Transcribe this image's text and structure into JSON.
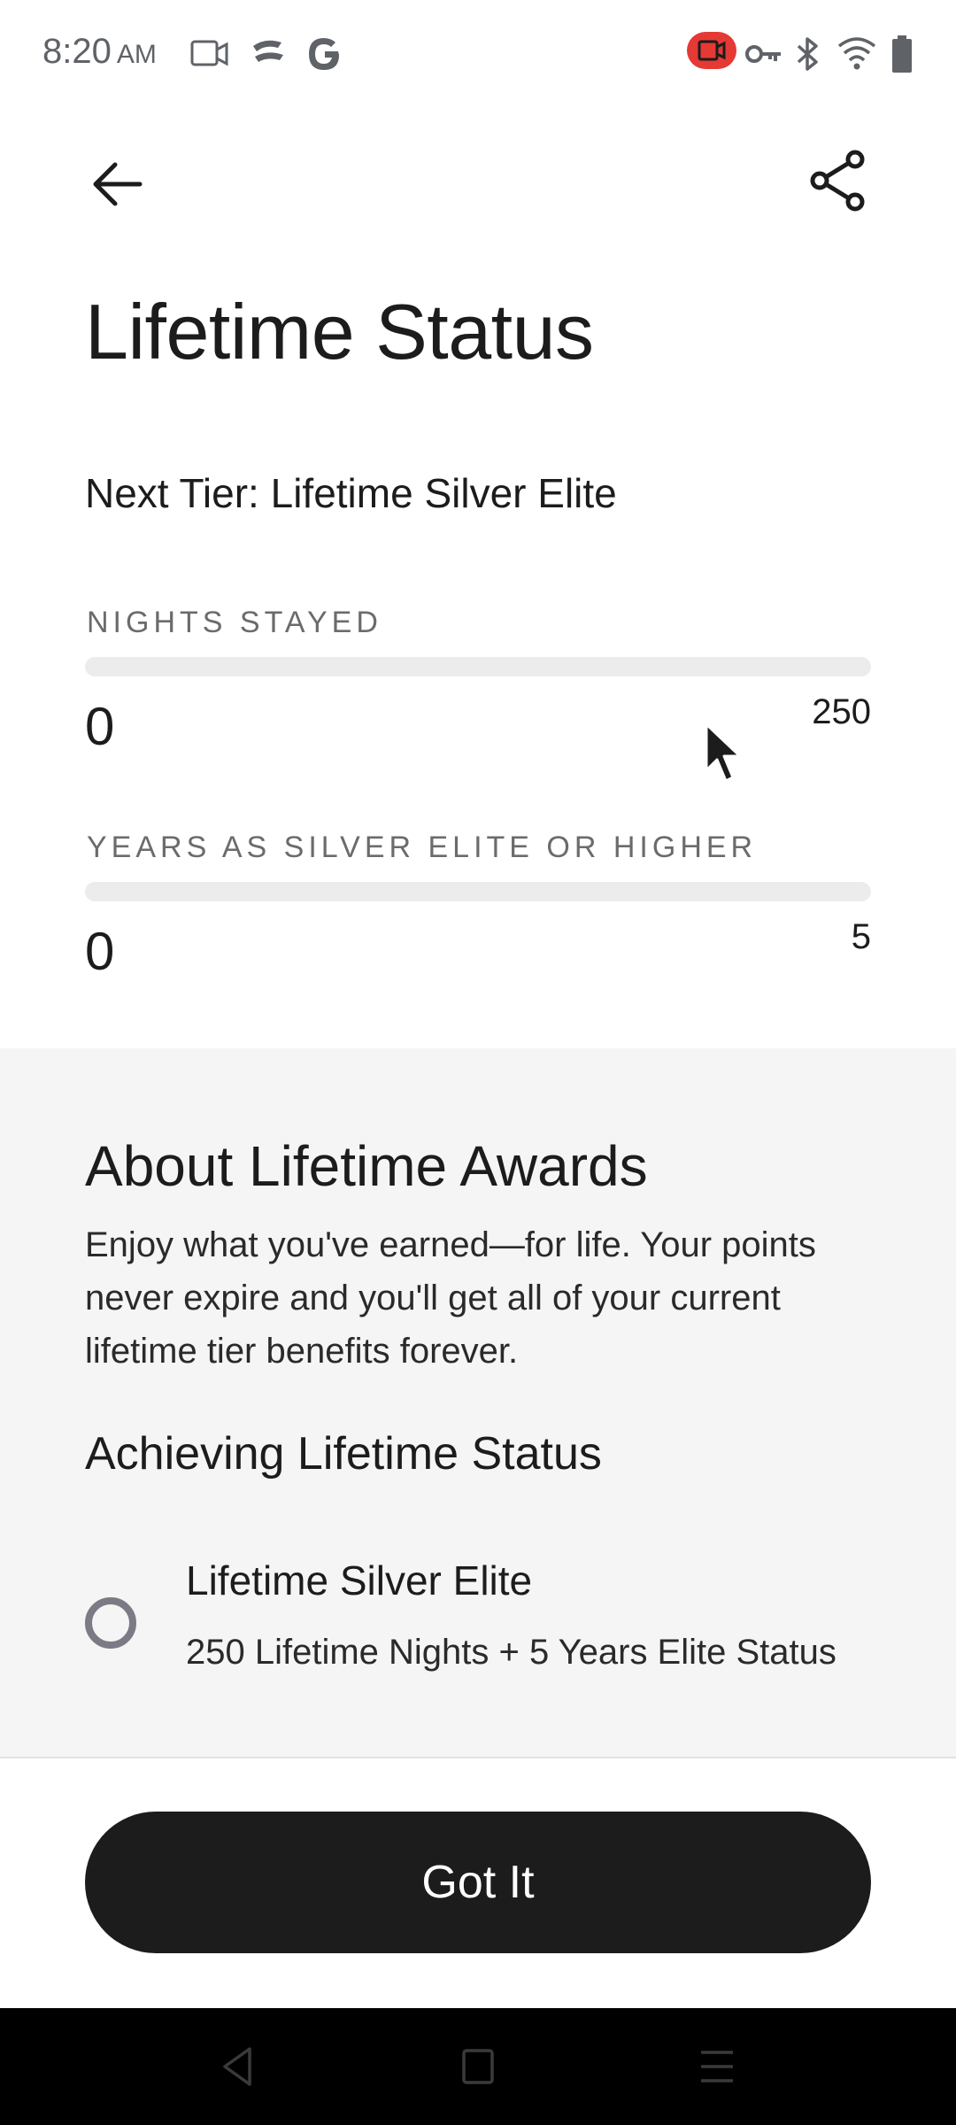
{
  "status_bar": {
    "time": "8:20",
    "ampm": "AM",
    "icons": [
      "screen-record-icon",
      "cast-icon",
      "google-g-icon",
      "recording-badge-icon",
      "vpn-key-icon",
      "bluetooth-icon",
      "wifi-icon",
      "battery-icon"
    ],
    "recording_color": "#e53935"
  },
  "header": {
    "back_icon": "arrow-left-icon",
    "share_icon": "share-icon"
  },
  "page": {
    "title": "Lifetime Status",
    "next_tier": "Next Tier: Lifetime Silver Elite"
  },
  "metrics": {
    "nights": {
      "label": "NIGHTS STAYED",
      "current": "0",
      "goal": "250",
      "progress": 0
    },
    "years": {
      "label": "YEARS AS SILVER ELITE OR HIGHER",
      "current": "0",
      "goal": "5",
      "progress": 0
    }
  },
  "about": {
    "title": "About Lifetime Awards",
    "body": "Enjoy what you've earned—for life. Your points never expire and you'll get all of your current lifetime tier benefits forever."
  },
  "achieving": {
    "title": "Achieving Lifetime Status",
    "tiers": [
      {
        "name": "Lifetime Silver Elite",
        "requirement": "250 Lifetime Nights + 5 Years Elite Status"
      }
    ]
  },
  "footer": {
    "button_label": "Got It"
  },
  "nav_bar": {
    "icons": [
      "back-triangle-icon",
      "home-square-icon",
      "recents-menu-icon"
    ]
  },
  "colors": {
    "primary": "#1c1c1c",
    "section_bg": "#f5f5f5",
    "track": "#ececec",
    "muted_label": "#6b6b6b"
  }
}
